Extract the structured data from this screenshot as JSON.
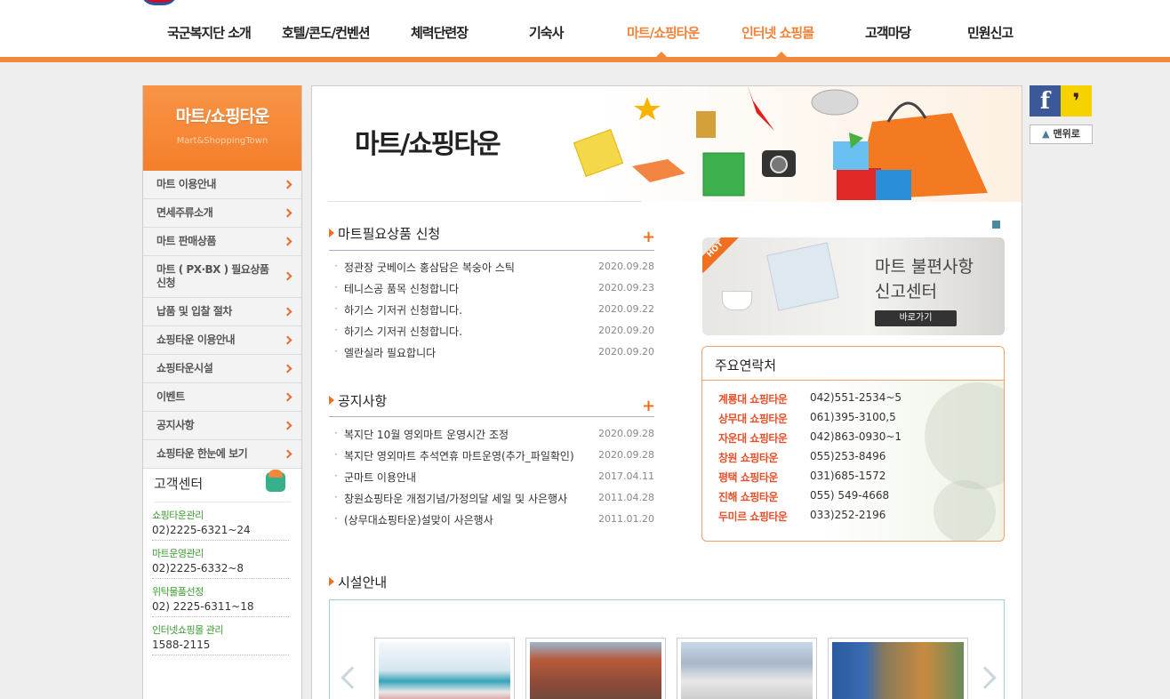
{
  "nav": {
    "items": [
      "국군복지단 소개",
      "호텔/콘도/컨벤션",
      "체력단련장",
      "기숙사",
      "마트/쇼핑타운",
      "인터넷 쇼핑몰",
      "고객마당",
      "민원신고"
    ]
  },
  "sidebar": {
    "title": "마트/쇼핑타운",
    "subtitle": "Mart&ShoppingTown",
    "items": [
      "마트 이용안내",
      "면세주류소개",
      "마트 판매상품",
      "마트 ( PX·BX ) 필요상품 신청",
      "납품 및 입찰 절차",
      "쇼핑타운 이용안내",
      "쇼핑타운시설",
      "이벤트",
      "공지사항",
      "쇼핑타운 한눈에 보기"
    ],
    "cs_title": "고객센터",
    "cs": [
      {
        "name": "쇼핑타운관리",
        "phone": "02)2225-6321~24"
      },
      {
        "name": "마트운영관리",
        "phone": "02)2225-6332~8"
      },
      {
        "name": "위탁물품선정",
        "phone": "02) 2225-6311~18"
      },
      {
        "name": "인터넷쇼핑몰 관리",
        "phone": "1588-2115"
      }
    ]
  },
  "main": {
    "banner_title": "마트/쇼핑타운",
    "request": {
      "title": "마트필요상품 신청",
      "posts": [
        {
          "title": "정관장 굿베이스 홍삼담은 복숭아 스틱",
          "date": "2020.09.28"
        },
        {
          "title": "테니스공 품목 신청합니다",
          "date": "2020.09.23"
        },
        {
          "title": "하기스 기저귀 신청합니다.",
          "date": "2020.09.22"
        },
        {
          "title": "하기스 기저귀 신청합니다.",
          "date": "2020.09.20"
        },
        {
          "title": "엘란실라 필요합니다",
          "date": "2020.09.20"
        }
      ]
    },
    "notice": {
      "title": "공지사항",
      "posts": [
        {
          "title": "복지단 10월 영외마트 운영시간 조정",
          "date": "2020.09.28"
        },
        {
          "title": "복지단 영외마트 추석연휴 마트운영(추가_파일확인)",
          "date": "2020.09.28"
        },
        {
          "title": "군마트 이용안내",
          "date": "2017.04.11"
        },
        {
          "title": "창원쇼핑타운 개점기념/가정의달 세일 및 사은행사",
          "date": "2011.04.28"
        },
        {
          "title": "(상무대쇼핑타운)설맞이 사은행사",
          "date": "2011.01.20"
        }
      ]
    },
    "hot_banner": {
      "tag": "HOT",
      "line1": "마트 불편사항",
      "line2": "신고센터",
      "button": "바로가기"
    },
    "contacts": {
      "title": "주요연락처",
      "rows": [
        {
          "name": "계룡대 쇼핑타운",
          "phone": "042)551-2534~5"
        },
        {
          "name": "상무대 쇼핑타운",
          "phone": "061)395-3100,5"
        },
        {
          "name": "자운대 쇼핑타운",
          "phone": "042)863-0930~1"
        },
        {
          "name": "창원 쇼핑타운",
          "phone": "055)253-8496"
        },
        {
          "name": "평택 쇼핑타운",
          "phone": "031)685-1572"
        },
        {
          "name": "진해 쇼핑타운",
          "phone": "055) 549-4668"
        },
        {
          "name": "두미르 쇼핑타운",
          "phone": "033)252-2196"
        }
      ]
    },
    "facility": {
      "title": "시설안내"
    }
  },
  "float": {
    "top_label": "맨위로"
  },
  "colors": {
    "accent": "#f08a3a",
    "brand_orange": "#f47f2a",
    "contact_name": "#e8502a",
    "facebook": "#3b5998",
    "kakao": "#f6d200"
  }
}
